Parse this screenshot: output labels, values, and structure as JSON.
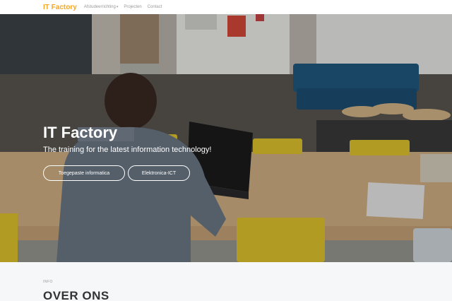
{
  "nav": {
    "brand": "IT Factory",
    "items": [
      {
        "label": "Afstudeerrichting",
        "has_dropdown": true
      },
      {
        "label": "Projecten",
        "has_dropdown": false
      },
      {
        "label": "Contact",
        "has_dropdown": false
      }
    ]
  },
  "hero": {
    "title": "IT Factory",
    "subtitle": "The training for the latest information technology!",
    "buttons": [
      {
        "label": "Toegepaste informatica"
      },
      {
        "label": "Elektronica-ICT"
      }
    ]
  },
  "intro": {
    "kicker": "INFO",
    "title": "OVER ONS"
  },
  "colors": {
    "brand": "#f5a623",
    "section_bg": "#f6f7f9"
  }
}
